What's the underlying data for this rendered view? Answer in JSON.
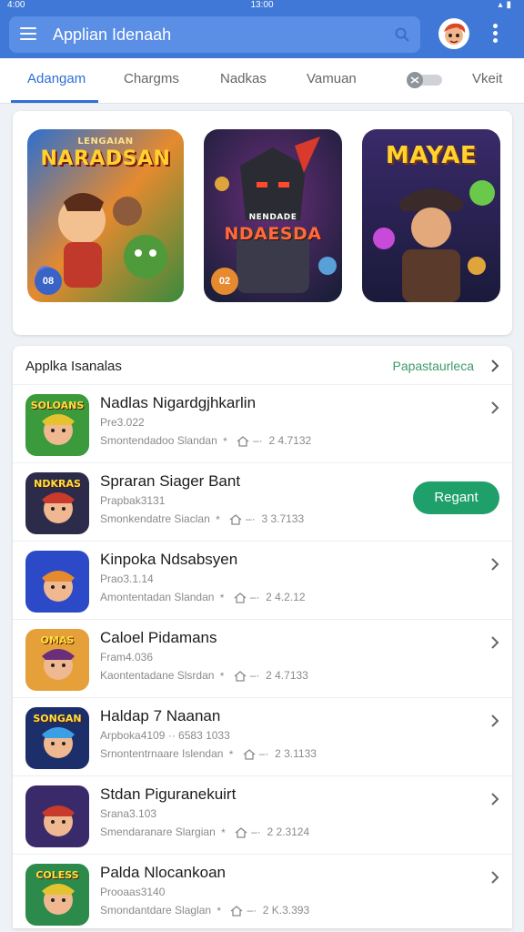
{
  "status_bar": {
    "left": "4:00",
    "time": "13:00"
  },
  "app_bar": {
    "title": "Applian Idenaah"
  },
  "tabs": [
    {
      "label": "Adangam",
      "active": true
    },
    {
      "label": "Chargms",
      "active": false
    },
    {
      "label": "Nadkas",
      "active": false
    },
    {
      "label": "Vamuan",
      "active": false
    },
    {
      "label": "Vkeit",
      "active": false
    }
  ],
  "banners": [
    {
      "title": "NARADSAN",
      "subtitle": "LENGAIAN",
      "badge": "08"
    },
    {
      "title": "NDAESDA",
      "subtitle": "NENDADE",
      "badge": "02"
    },
    {
      "title": "MAYAE",
      "subtitle": "",
      "badge": ""
    }
  ],
  "list": {
    "title": "Applka Isanalas",
    "link": "Papastaurleca",
    "items": [
      {
        "name": "Nadlas Nigardgjhkarlin",
        "sub": "Pre3.022",
        "meta_label": "Smontendadoo Slandan",
        "meta_value": "2 4.7132",
        "icon_text": "SOLOANS",
        "action": "chevron"
      },
      {
        "name": "Spraran Siager Bant",
        "sub": "Prapbak3131",
        "meta_label": "Smonkendatre Siaclan",
        "meta_value": "3 3.7133",
        "icon_text": "NDKRAS",
        "action": "button",
        "button_label": "Regant"
      },
      {
        "name": "Kinpoka Ndsabsyen",
        "sub": "Prao3.1.14",
        "meta_label": "Amontentadan Slandan",
        "meta_value": "2 4.2.12",
        "icon_text": "",
        "action": "chevron"
      },
      {
        "name": "Caloel Pidamans",
        "sub": "Fram4.036",
        "meta_label": "Kaontentadane Slsrdan",
        "meta_value": "2 4.7133",
        "icon_text": "OMAS",
        "action": "chevron"
      },
      {
        "name": "Haldap 7 Naanan",
        "sub": "Arpboka4109 ·· 6583 1033",
        "meta_label": "Srnontentrnaare Islendan",
        "meta_value": "2 3.1133",
        "icon_text": "SONGAN",
        "action": "chevron"
      },
      {
        "name": "Stdan Piguranekuirt",
        "sub": "Srana3.103",
        "meta_label": "Smendaranare Slargian",
        "meta_value": "2 2.3124",
        "icon_text": "",
        "action": "chevron"
      },
      {
        "name": "Palda Nlocankoan",
        "sub": "Prooaas3140",
        "meta_label": "Smondantdare Slaglan",
        "meta_value": "2 K.3.393",
        "icon_text": "COLESS",
        "action": "chevron"
      }
    ]
  },
  "colors": {
    "accent": "#3f78d6",
    "green": "#1fa06b",
    "link": "#3d9a6b"
  }
}
